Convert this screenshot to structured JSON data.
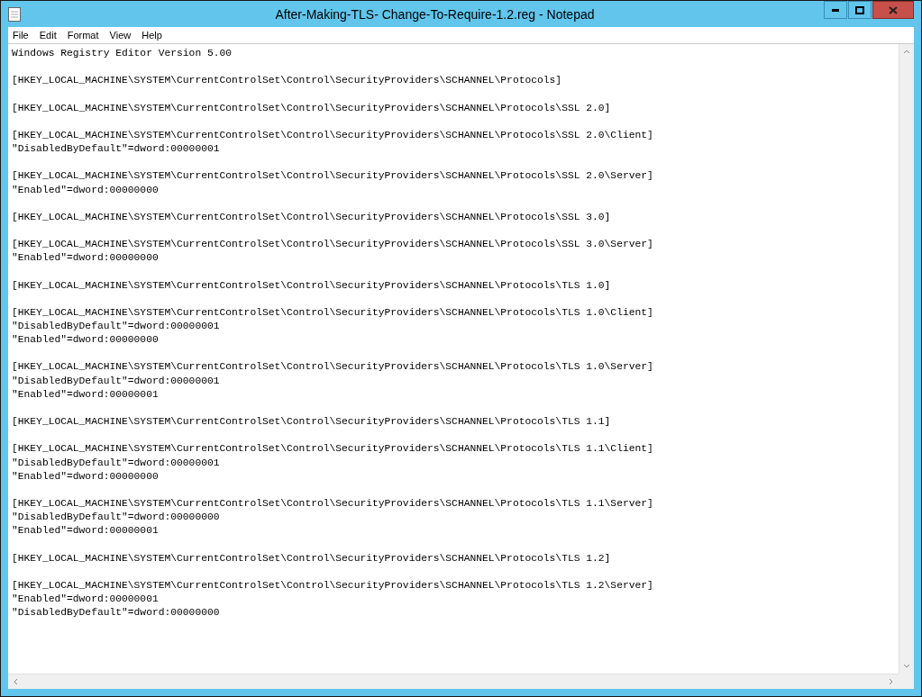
{
  "window": {
    "title": "After-Making-TLS- Change-To-Require-1.2.reg - Notepad"
  },
  "menu": [
    "File",
    "Edit",
    "Format",
    "View",
    "Help"
  ],
  "document": {
    "blocks": [
      [
        "Windows Registry Editor Version 5.00"
      ],
      [
        "[HKEY_LOCAL_MACHINE\\SYSTEM\\CurrentControlSet\\Control\\SecurityProviders\\SCHANNEL\\Protocols]"
      ],
      [
        "[HKEY_LOCAL_MACHINE\\SYSTEM\\CurrentControlSet\\Control\\SecurityProviders\\SCHANNEL\\Protocols\\SSL 2.0]"
      ],
      [
        "[HKEY_LOCAL_MACHINE\\SYSTEM\\CurrentControlSet\\Control\\SecurityProviders\\SCHANNEL\\Protocols\\SSL 2.0\\Client]",
        "\"DisabledByDefault\"=dword:00000001"
      ],
      [
        "[HKEY_LOCAL_MACHINE\\SYSTEM\\CurrentControlSet\\Control\\SecurityProviders\\SCHANNEL\\Protocols\\SSL 2.0\\Server]",
        "\"Enabled\"=dword:00000000"
      ],
      [
        "[HKEY_LOCAL_MACHINE\\SYSTEM\\CurrentControlSet\\Control\\SecurityProviders\\SCHANNEL\\Protocols\\SSL 3.0]"
      ],
      [
        "[HKEY_LOCAL_MACHINE\\SYSTEM\\CurrentControlSet\\Control\\SecurityProviders\\SCHANNEL\\Protocols\\SSL 3.0\\Server]",
        "\"Enabled\"=dword:00000000"
      ],
      [
        "[HKEY_LOCAL_MACHINE\\SYSTEM\\CurrentControlSet\\Control\\SecurityProviders\\SCHANNEL\\Protocols\\TLS 1.0]"
      ],
      [
        "[HKEY_LOCAL_MACHINE\\SYSTEM\\CurrentControlSet\\Control\\SecurityProviders\\SCHANNEL\\Protocols\\TLS 1.0\\Client]",
        "\"DisabledByDefault\"=dword:00000001",
        "\"Enabled\"=dword:00000000"
      ],
      [
        "[HKEY_LOCAL_MACHINE\\SYSTEM\\CurrentControlSet\\Control\\SecurityProviders\\SCHANNEL\\Protocols\\TLS 1.0\\Server]",
        "\"DisabledByDefault\"=dword:00000001",
        "\"Enabled\"=dword:00000001"
      ],
      [
        "[HKEY_LOCAL_MACHINE\\SYSTEM\\CurrentControlSet\\Control\\SecurityProviders\\SCHANNEL\\Protocols\\TLS 1.1]"
      ],
      [
        "[HKEY_LOCAL_MACHINE\\SYSTEM\\CurrentControlSet\\Control\\SecurityProviders\\SCHANNEL\\Protocols\\TLS 1.1\\Client]",
        "\"DisabledByDefault\"=dword:00000001",
        "\"Enabled\"=dword:00000000"
      ],
      [
        "[HKEY_LOCAL_MACHINE\\SYSTEM\\CurrentControlSet\\Control\\SecurityProviders\\SCHANNEL\\Protocols\\TLS 1.1\\Server]",
        "\"DisabledByDefault\"=dword:00000000",
        "\"Enabled\"=dword:00000001"
      ],
      [
        "[HKEY_LOCAL_MACHINE\\SYSTEM\\CurrentControlSet\\Control\\SecurityProviders\\SCHANNEL\\Protocols\\TLS 1.2]"
      ],
      [
        "[HKEY_LOCAL_MACHINE\\SYSTEM\\CurrentControlSet\\Control\\SecurityProviders\\SCHANNEL\\Protocols\\TLS 1.2\\Server]",
        "\"Enabled\"=dword:00000001",
        "\"DisabledByDefault\"=dword:00000000"
      ]
    ]
  }
}
